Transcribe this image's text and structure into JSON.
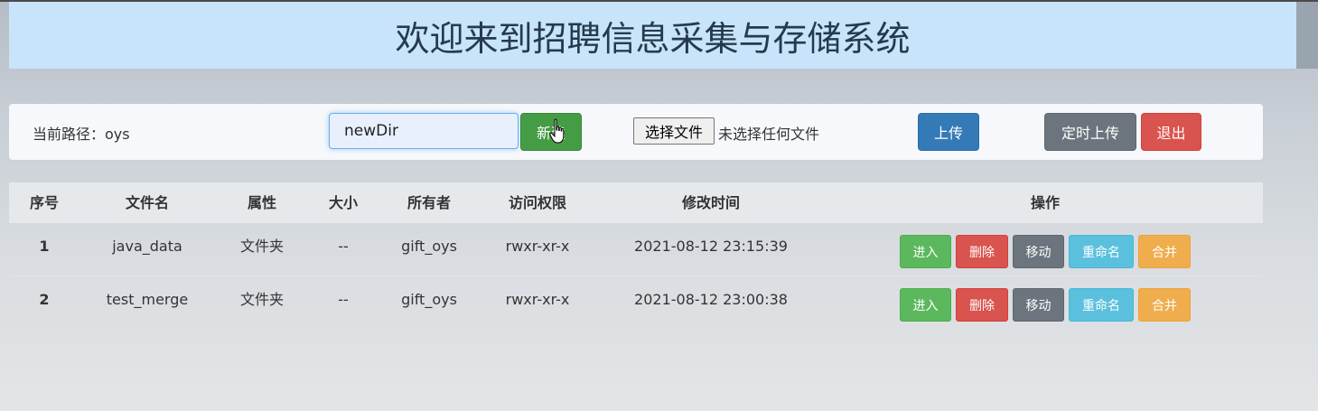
{
  "header": {
    "title": "欢迎来到招聘信息采集与存储系统"
  },
  "toolbar": {
    "path_label": "当前路径：oys",
    "dir_input_value": "newDir",
    "new_button": "新建",
    "file_button": "选择文件",
    "file_status": "未选择任何文件",
    "upload_button": "上传",
    "timed_upload_button": "定时上传",
    "exit_button": "退出"
  },
  "table": {
    "headers": [
      "序号",
      "文件名",
      "属性",
      "大小",
      "所有者",
      "访问权限",
      "修改时间",
      "操作"
    ],
    "rows": [
      {
        "index": "1",
        "name": "java_data",
        "type": "文件夹",
        "size": "--",
        "owner": "gift_oys",
        "perm": "rwxr-xr-x",
        "mtime": "2021-08-12 23:15:39"
      },
      {
        "index": "2",
        "name": "test_merge",
        "type": "文件夹",
        "size": "--",
        "owner": "gift_oys",
        "perm": "rwxr-xr-x",
        "mtime": "2021-08-12 23:00:38"
      }
    ],
    "actions": {
      "enter": "进入",
      "delete": "删除",
      "move": "移动",
      "rename": "重命名",
      "merge": "合并"
    }
  },
  "colors": {
    "title_bg": "#c8e4fa",
    "success": "#5cb85c",
    "danger": "#d9534f",
    "secondary": "#6c757d",
    "info": "#5bc0de",
    "warning": "#f0ad4e",
    "primary": "#337ab7"
  },
  "icons": {
    "cursor": "hand-pointer-icon"
  }
}
